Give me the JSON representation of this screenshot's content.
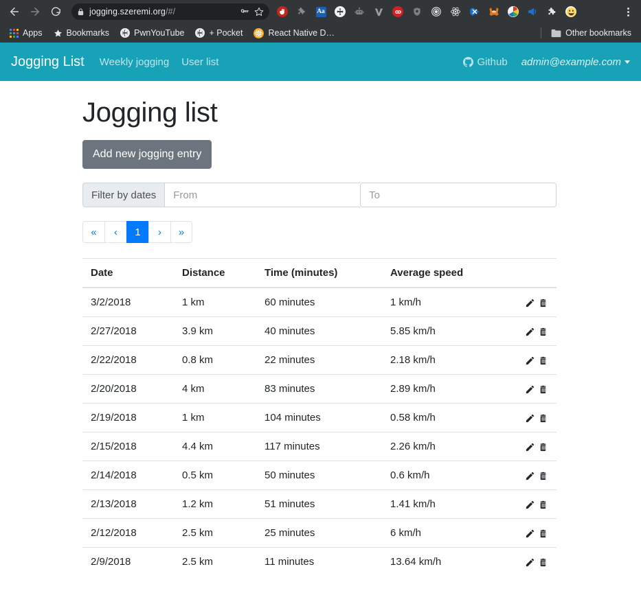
{
  "browser": {
    "nav": {
      "back_icon": "arrow-left-icon",
      "forward_icon": "arrow-right-icon",
      "reload_icon": "reload-icon"
    },
    "omnibox": {
      "lock_icon": "lock-icon",
      "url_main": "jogging.szeremi.org",
      "url_path": "/#/",
      "key_icon": "key-icon",
      "star_icon": "star-icon"
    },
    "extensions": [
      {
        "name": "ublock-origin-icon",
        "label": ""
      },
      {
        "name": "puzzle-gray-icon",
        "label": ""
      },
      {
        "name": "font-size-aa-icon",
        "label": "Aa"
      },
      {
        "name": "compass-move-icon",
        "label": ""
      },
      {
        "name": "robot-icon",
        "label": ""
      },
      {
        "name": "vimium-v-icon",
        "label": "V"
      },
      {
        "name": "honey-icon",
        "label": ""
      },
      {
        "name": "bug-shield-icon",
        "label": ""
      },
      {
        "name": "bullseye-target-icon",
        "label": ""
      },
      {
        "name": "react-devtools-icon",
        "label": ""
      },
      {
        "name": "blue-x-icon",
        "label": ""
      },
      {
        "name": "metamask-fox-icon",
        "label": ""
      },
      {
        "name": "color-wheel-icon",
        "label": ""
      },
      {
        "name": "megaphone-icon",
        "label": ""
      },
      {
        "name": "puzzle-extensions-icon",
        "label": ""
      },
      {
        "name": "emoji-smile-icon",
        "label": ""
      }
    ],
    "menu_icon": "three-dot-menu-icon",
    "bookmarks": [
      {
        "label": "Apps",
        "icon": "apps-grid-icon"
      },
      {
        "label": "Bookmarks",
        "icon": "star-icon"
      },
      {
        "label": "PwnYouTube",
        "icon": "globe-icon"
      },
      {
        "label": "+ Pocket",
        "icon": "globe-icon"
      },
      {
        "label": "React Native D…",
        "icon": "react-icon"
      }
    ],
    "other_bookmarks": {
      "label": "Other bookmarks",
      "icon": "folder-icon"
    }
  },
  "app": {
    "brand": "Jogging List",
    "nav_links": [
      {
        "label": "Weekly jogging"
      },
      {
        "label": "User list"
      }
    ],
    "github": {
      "label": "Github",
      "icon": "github-icon"
    },
    "user": {
      "email": "admin@example.com",
      "caret_icon": "chevron-down-icon"
    },
    "navbar_color": "#17a2b8"
  },
  "main": {
    "title": "Jogging list",
    "add_button": "Add new jogging entry",
    "filter": {
      "label": "Filter by dates",
      "from_placeholder": "From",
      "from_value": "",
      "to_placeholder": "To",
      "to_value": ""
    },
    "pagination": {
      "items": [
        {
          "label": "«",
          "active": false,
          "name": "pagination-first"
        },
        {
          "label": "‹",
          "active": false,
          "name": "pagination-prev"
        },
        {
          "label": "1",
          "active": true,
          "name": "pagination-page-1"
        },
        {
          "label": "›",
          "active": false,
          "name": "pagination-next"
        },
        {
          "label": "»",
          "active": false,
          "name": "pagination-last"
        }
      ],
      "active_color": "#007bff"
    },
    "table": {
      "columns": [
        "Date",
        "Distance",
        "Time (minutes)",
        "Average speed",
        ""
      ],
      "rows": [
        {
          "date": "3/2/2018",
          "distance": "1 km",
          "time": "60 minutes",
          "speed": "1 km/h"
        },
        {
          "date": "2/27/2018",
          "distance": "3.9 km",
          "time": "40 minutes",
          "speed": "5.85 km/h"
        },
        {
          "date": "2/22/2018",
          "distance": "0.8 km",
          "time": "22 minutes",
          "speed": "2.18 km/h"
        },
        {
          "date": "2/20/2018",
          "distance": "4 km",
          "time": "83 minutes",
          "speed": "2.89 km/h"
        },
        {
          "date": "2/19/2018",
          "distance": "1 km",
          "time": "104 minutes",
          "speed": "0.58 km/h"
        },
        {
          "date": "2/15/2018",
          "distance": "4.4 km",
          "time": "117 minutes",
          "speed": "2.26 km/h"
        },
        {
          "date": "2/14/2018",
          "distance": "0.5 km",
          "time": "50 minutes",
          "speed": "0.6 km/h"
        },
        {
          "date": "2/13/2018",
          "distance": "1.2 km",
          "time": "51 minutes",
          "speed": "1.41 km/h"
        },
        {
          "date": "2/12/2018",
          "distance": "2.5 km",
          "time": "25 minutes",
          "speed": "6 km/h"
        },
        {
          "date": "2/9/2018",
          "distance": "2.5 km",
          "time": "11 minutes",
          "speed": "13.64 km/h"
        }
      ],
      "row_actions": [
        {
          "name": "edit-icon"
        },
        {
          "name": "delete-icon"
        }
      ]
    }
  }
}
